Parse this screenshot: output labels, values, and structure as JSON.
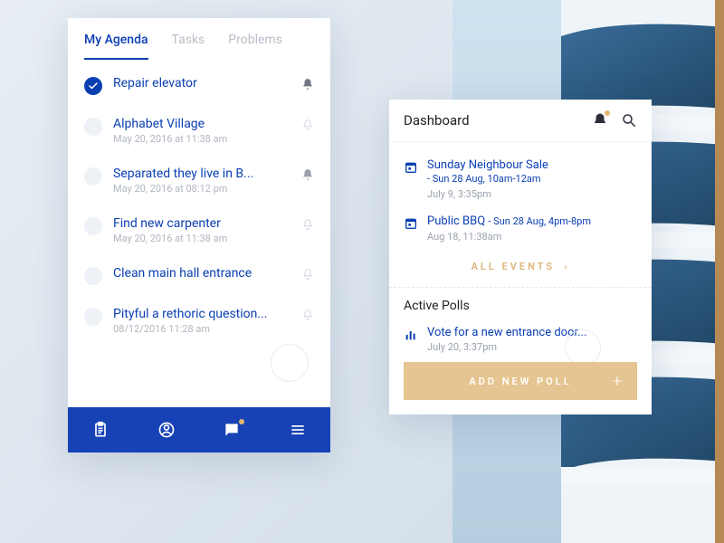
{
  "left_panel": {
    "tabs": [
      {
        "label": "My Agenda",
        "active": true
      },
      {
        "label": "Tasks",
        "active": false
      },
      {
        "label": "Problems",
        "active": false
      }
    ],
    "items": [
      {
        "title": "Repair elevator",
        "meta": "",
        "completed": true,
        "bell_active": true
      },
      {
        "title": "Alphabet Village",
        "meta": "May 20, 2016 at 11:38 am",
        "completed": false,
        "bell_active": false
      },
      {
        "title": "Separated they live in B...",
        "meta": "May 20, 2016 at 08:12 pm",
        "completed": false,
        "bell_active": true
      },
      {
        "title": "Find new carpenter",
        "meta": "May 20, 2016 at 11:38 am",
        "completed": false,
        "bell_active": false
      },
      {
        "title": "Clean main hall entrance",
        "meta": "",
        "completed": false,
        "bell_active": false
      },
      {
        "title": "Pityful a rethoric question...",
        "meta": "08/12/2016 11:28 am",
        "completed": false,
        "bell_active": false
      }
    ]
  },
  "right_panel": {
    "header_title": "Dashboard",
    "events": [
      {
        "title": "Sunday Neighbour Sale",
        "sub": "- Sun 28 Aug, 10am-12am",
        "posted": "July 9, 3:35pm"
      },
      {
        "title": "Public BBQ",
        "sub": "- Sun 28 Aug, 4pm-8pm",
        "posted": "Aug 18, 11:38am"
      }
    ],
    "all_events_label": "ALL EVENTS",
    "polls_title": "Active Polls",
    "polls": [
      {
        "title": "Vote for a new entrance door...",
        "meta": "July 20, 3:37pm"
      }
    ],
    "add_poll_label": "ADD NEW POLL"
  }
}
